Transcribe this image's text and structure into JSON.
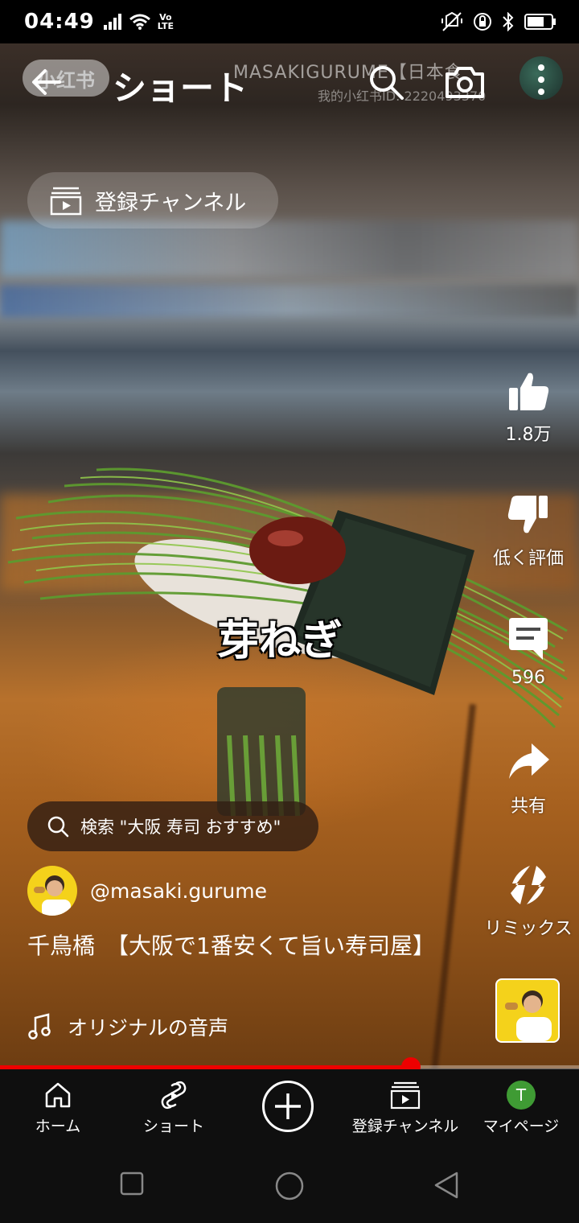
{
  "status_bar": {
    "time": "04:49",
    "volte_top": "Vo",
    "volte_bottom": "LTE"
  },
  "watermark": {
    "logo": "小红书",
    "title": "MASAKIGURUME【日本食",
    "id": "我的小红书ID: 2220493370"
  },
  "top_bar": {
    "title": "ショート",
    "subscriptions_pill": "登録チャンネル"
  },
  "video": {
    "caption": "芽ねぎ",
    "progress_fraction": 0.71
  },
  "actions": {
    "like_count": "1.8万",
    "dislike_label": "低く評価",
    "comment_count": "596",
    "share_label": "共有",
    "remix_label": "リミックス"
  },
  "search_suggestion": {
    "text": "検索 \"大阪 寿司 おすすめ\""
  },
  "channel": {
    "handle": "@masaki.gurume"
  },
  "video_title": "千鳥橋　【大阪で1番安くて旨い寿司屋】",
  "music": {
    "label": "オリジナルの音声"
  },
  "bottom_nav": {
    "home": "ホーム",
    "shorts": "ショート",
    "subscriptions": "登録チャンネル",
    "my_page": "マイページ",
    "avatar_letter": "T"
  },
  "colors": {
    "accent_red": "#ee0000",
    "avatar_green": "#3f9b34",
    "channel_yellow": "#f4d21b"
  }
}
